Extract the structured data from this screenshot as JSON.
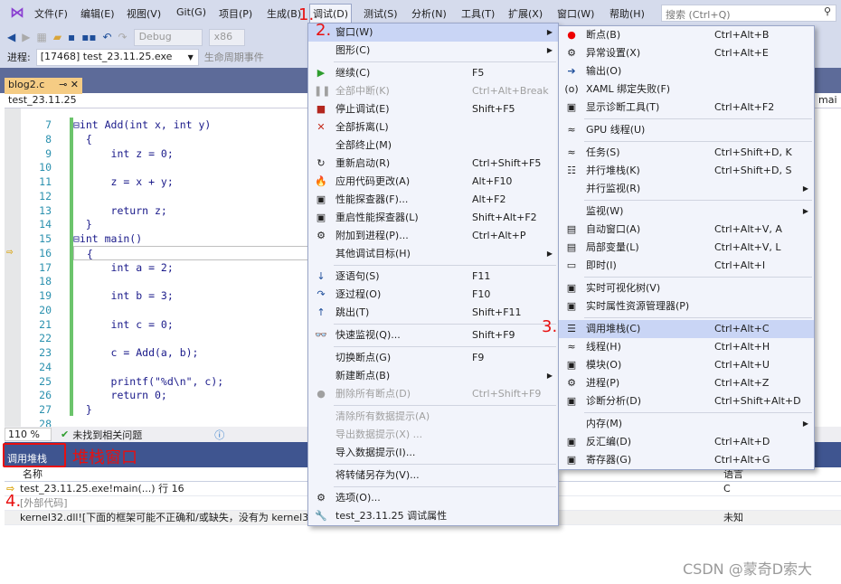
{
  "menubar": {
    "items": [
      "文件(F)",
      "编辑(E)",
      "视图(V)",
      "Git(G)",
      "项目(P)",
      "生成(B)",
      "调试(D)",
      "测试(S)",
      "分析(N)",
      "工具(T)",
      "扩展(X)",
      "窗口(W)",
      "帮助(H)"
    ],
    "open_index": 6,
    "search_placeholder": "搜索 (Ctrl+Q)"
  },
  "toolbar": {
    "config": "Debug",
    "platform": "x86",
    "process_label": "进程:",
    "process": "[17468] test_23.11.25.exe",
    "lifecycle": "生命周期事件"
  },
  "document": {
    "tab": "blog2.c",
    "nav_scope": "test_23.11.25",
    "nav_func": "mai"
  },
  "editor": {
    "lines": [
      {
        "n": 7,
        "t": "⊟int Add(int x, int y)"
      },
      {
        "n": 8,
        "t": "  {"
      },
      {
        "n": 9,
        "t": "      int z = 0;"
      },
      {
        "n": 10,
        "t": ""
      },
      {
        "n": 11,
        "t": "      z = x + y;"
      },
      {
        "n": 12,
        "t": ""
      },
      {
        "n": 13,
        "t": "      return z;"
      },
      {
        "n": 14,
        "t": "  }"
      },
      {
        "n": 15,
        "t": "⊟int main()"
      },
      {
        "n": 16,
        "t": "  {"
      },
      {
        "n": 17,
        "t": "      int a = 2;"
      },
      {
        "n": 18,
        "t": ""
      },
      {
        "n": 19,
        "t": "      int b = 3;"
      },
      {
        "n": 20,
        "t": ""
      },
      {
        "n": 21,
        "t": "      int c = 0;"
      },
      {
        "n": 22,
        "t": ""
      },
      {
        "n": 23,
        "t": "      c = Add(a, b);"
      },
      {
        "n": 24,
        "t": ""
      },
      {
        "n": 25,
        "t": "      printf(\"%d\\n\", c);"
      },
      {
        "n": 26,
        "t": "      return 0;"
      },
      {
        "n": 27,
        "t": "  }"
      },
      {
        "n": 28,
        "t": ""
      }
    ],
    "current_line": 16
  },
  "status": {
    "zoom": "110 %",
    "issues": "未找到相关问题"
  },
  "callstack": {
    "title": "调用堆栈",
    "annotation": "堆栈窗口",
    "headers": [
      "名称",
      "语言"
    ],
    "rows": [
      {
        "name": "test_23.11.25.exe!main(...) 行 16",
        "lang": "C",
        "current": true
      },
      {
        "name": "[外部代码]",
        "lang": "",
        "external": true
      },
      {
        "name": "kernel32.dll![下面的框架可能不正确和/或缺失，没有为 kernel32",
        "lang": "未知"
      }
    ]
  },
  "debug_menu": [
    {
      "icon": "",
      "label": "窗口(W)",
      "sub": true,
      "hl": true
    },
    {
      "icon": "",
      "label": "图形(C)",
      "sub": true
    },
    {
      "sep": true
    },
    {
      "icon": "▶",
      "color": "#2e9d2e",
      "label": "继续(C)",
      "sc": "F5"
    },
    {
      "icon": "❚❚",
      "label": "全部中断(K)",
      "sc": "Ctrl+Alt+Break",
      "dis": true
    },
    {
      "icon": "■",
      "color": "#b3261e",
      "label": "停止调试(E)",
      "sc": "Shift+F5"
    },
    {
      "icon": "✕",
      "color": "#c42b1c",
      "label": "全部拆离(L)"
    },
    {
      "icon": "",
      "label": "全部终止(M)"
    },
    {
      "icon": "↻",
      "label": "重新启动(R)",
      "sc": "Ctrl+Shift+F5"
    },
    {
      "icon": "🔥",
      "color": "#d9481c",
      "label": "应用代码更改(A)",
      "sc": "Alt+F10"
    },
    {
      "icon": "▣",
      "label": "性能探查器(F)...",
      "sc": "Alt+F2"
    },
    {
      "icon": "▣",
      "label": "重启性能探查器(L)",
      "sc": "Shift+Alt+F2"
    },
    {
      "icon": "⚙",
      "label": "附加到进程(P)...",
      "sc": "Ctrl+Alt+P"
    },
    {
      "icon": "",
      "label": "其他调试目标(H)",
      "sub": true
    },
    {
      "sep": true
    },
    {
      "icon": "↓",
      "color": "#1e4e9a",
      "label": "逐语句(S)",
      "sc": "F11"
    },
    {
      "icon": "↷",
      "color": "#1e4e9a",
      "label": "逐过程(O)",
      "sc": "F10"
    },
    {
      "icon": "↑",
      "color": "#1e4e9a",
      "label": "跳出(T)",
      "sc": "Shift+F11"
    },
    {
      "sep": true
    },
    {
      "icon": "👓",
      "label": "快速监视(Q)...",
      "sc": "Shift+F9"
    },
    {
      "sep": true
    },
    {
      "icon": "",
      "label": "切换断点(G)",
      "sc": "F9"
    },
    {
      "icon": "",
      "label": "新建断点(B)",
      "sub": true
    },
    {
      "icon": "●",
      "label": "删除所有断点(D)",
      "sc": "Ctrl+Shift+F9",
      "dis": true
    },
    {
      "sep": true
    },
    {
      "icon": "",
      "label": "清除所有数据提示(A)",
      "dis": true
    },
    {
      "icon": "",
      "label": "导出数据提示(X) ...",
      "dis": true
    },
    {
      "icon": "",
      "label": "导入数据提示(I)..."
    },
    {
      "sep": true
    },
    {
      "icon": "",
      "label": "将转储另存为(V)..."
    },
    {
      "sep": true
    },
    {
      "icon": "⚙",
      "label": "选项(O)..."
    },
    {
      "icon": "🔧",
      "label": "test_23.11.25 调试属性"
    }
  ],
  "window_menu": [
    {
      "icon": "●",
      "color": "#e00",
      "label": "断点(B)",
      "sc": "Ctrl+Alt+B"
    },
    {
      "icon": "⚙",
      "label": "异常设置(X)",
      "sc": "Ctrl+Alt+E"
    },
    {
      "icon": "➔",
      "color": "#1e4e9a",
      "label": "输出(O)"
    },
    {
      "icon": "(o)",
      "label": "XAML 绑定失败(F)"
    },
    {
      "icon": "▣",
      "label": "显示诊断工具(T)",
      "sc": "Ctrl+Alt+F2"
    },
    {
      "sep": true
    },
    {
      "icon": "≈",
      "label": "GPU 线程(U)"
    },
    {
      "sep": true
    },
    {
      "icon": "≈",
      "label": "任务(S)",
      "sc": "Ctrl+Shift+D, K"
    },
    {
      "icon": "☷",
      "label": "并行堆栈(K)",
      "sc": "Ctrl+Shift+D, S"
    },
    {
      "icon": "",
      "label": "并行监视(R)",
      "sub": true
    },
    {
      "sep": true
    },
    {
      "icon": "",
      "label": "监视(W)",
      "sub": true
    },
    {
      "icon": "▤",
      "label": "自动窗口(A)",
      "sc": "Ctrl+Alt+V, A"
    },
    {
      "icon": "▤",
      "label": "局部变量(L)",
      "sc": "Ctrl+Alt+V, L"
    },
    {
      "icon": "▭",
      "label": "即时(I)",
      "sc": "Ctrl+Alt+I"
    },
    {
      "sep": true
    },
    {
      "icon": "▣",
      "label": "实时可视化树(V)"
    },
    {
      "icon": "▣",
      "label": "实时属性资源管理器(P)"
    },
    {
      "sep": true
    },
    {
      "icon": "☰",
      "label": "调用堆栈(C)",
      "sc": "Ctrl+Alt+C",
      "hl": true
    },
    {
      "icon": "≈",
      "label": "线程(H)",
      "sc": "Ctrl+Alt+H"
    },
    {
      "icon": "▣",
      "label": "模块(O)",
      "sc": "Ctrl+Alt+U"
    },
    {
      "icon": "⚙",
      "label": "进程(P)",
      "sc": "Ctrl+Alt+Z"
    },
    {
      "icon": "▣",
      "label": "诊断分析(D)",
      "sc": "Ctrl+Shift+Alt+D"
    },
    {
      "sep": true
    },
    {
      "icon": "",
      "label": "内存(M)",
      "sub": true
    },
    {
      "icon": "▣",
      "label": "反汇编(D)",
      "sc": "Ctrl+Alt+D"
    },
    {
      "icon": "▣",
      "label": "寄存器(G)",
      "sc": "Ctrl+Alt+G"
    }
  ],
  "annotations": [
    "1.",
    "2.",
    "3.",
    "4."
  ],
  "watermark": "CSDN @蒙奇D索大",
  "colors": {
    "accent": "#3f5590",
    "highlight": "#c9d5f5",
    "annotation": "#e81010",
    "tab": "#f5cc84"
  }
}
